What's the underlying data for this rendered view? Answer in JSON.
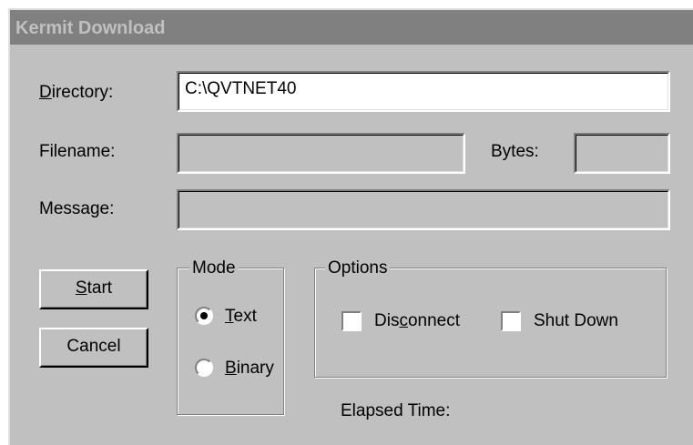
{
  "window": {
    "title": "Kermit Download"
  },
  "fields": {
    "directory_label_first": "D",
    "directory_label_rest": "irectory:",
    "directory_value": "C:\\QVTNET40",
    "filename_label": "Filename:",
    "filename_value": "",
    "bytes_label": "Bytes:",
    "bytes_value": "",
    "message_label": "Message:",
    "message_value": ""
  },
  "buttons": {
    "start_first": "S",
    "start_rest": "tart",
    "cancel": "Cancel"
  },
  "mode": {
    "title": "Mode",
    "text_first": "T",
    "text_rest": "ext",
    "text_selected": true,
    "binary_first": "B",
    "binary_rest": "inary",
    "binary_selected": false
  },
  "options": {
    "title": "Options",
    "disconnect_pre": "Dis",
    "disconnect_u": "c",
    "disconnect_post": "onnect",
    "disconnect_checked": false,
    "shutdown": "Shut Down",
    "shutdown_checked": false
  },
  "status": {
    "elapsed_label": "Elapsed Time:"
  }
}
